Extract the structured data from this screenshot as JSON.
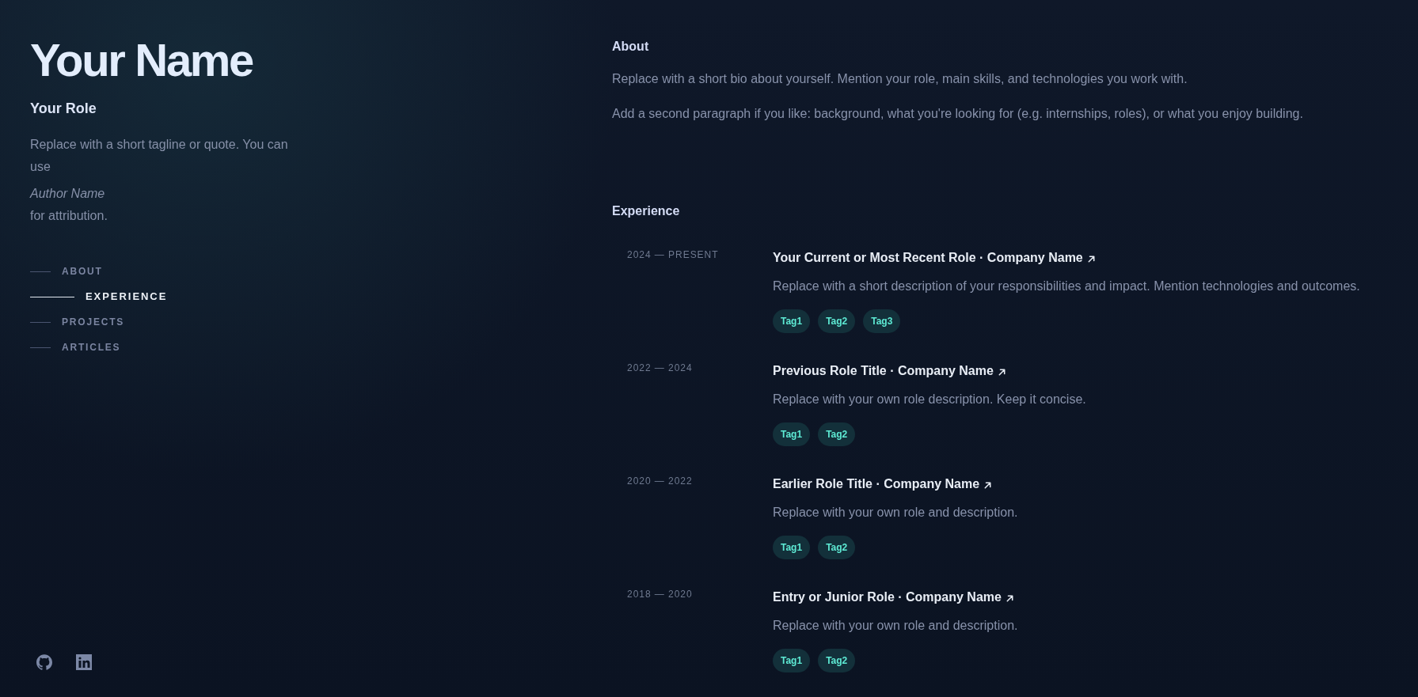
{
  "header": {
    "name": "Your Name",
    "role": "Your Role",
    "tagline": "Replace with a short tagline or quote. You can use *Author Name* for attribution."
  },
  "nav": [
    {
      "label": "ABOUT",
      "selected": false
    },
    {
      "label": "EXPERIENCE",
      "selected": true
    },
    {
      "label": "PROJECTS",
      "selected": false
    },
    {
      "label": "ARTICLES",
      "selected": false
    }
  ],
  "about": {
    "heading": "About",
    "paragraphs": [
      "Replace with a short bio about yourself. Mention your role, main skills, and technologies you work with.",
      "Add a second paragraph if you like: background, what you're looking for (e.g. internships, roles), or what you enjoy building."
    ]
  },
  "experience": {
    "heading": "Experience",
    "items": [
      {
        "dates": "2024 — PRESENT",
        "title": "Your Current or Most Recent Role · Company Name",
        "description": "Replace with a short description of your responsibilities and impact. Mention technologies and outcomes.",
        "tags": [
          "Tag1",
          "Tag2",
          "Tag3"
        ]
      },
      {
        "dates": "2022 — 2024",
        "title": "Previous Role Title · Company Name",
        "description": "Replace with your own role description. Keep it concise.",
        "tags": [
          "Tag1",
          "Tag2"
        ]
      },
      {
        "dates": "2020 — 2022",
        "title": "Earlier Role Title · Company Name",
        "description": "Replace with your own role and description.",
        "tags": [
          "Tag1",
          "Tag2"
        ]
      },
      {
        "dates": "2018 — 2020",
        "title": "Entry or Junior Role · Company Name",
        "description": "Replace with your own role and description.",
        "tags": [
          "Tag1",
          "Tag2"
        ]
      }
    ]
  }
}
